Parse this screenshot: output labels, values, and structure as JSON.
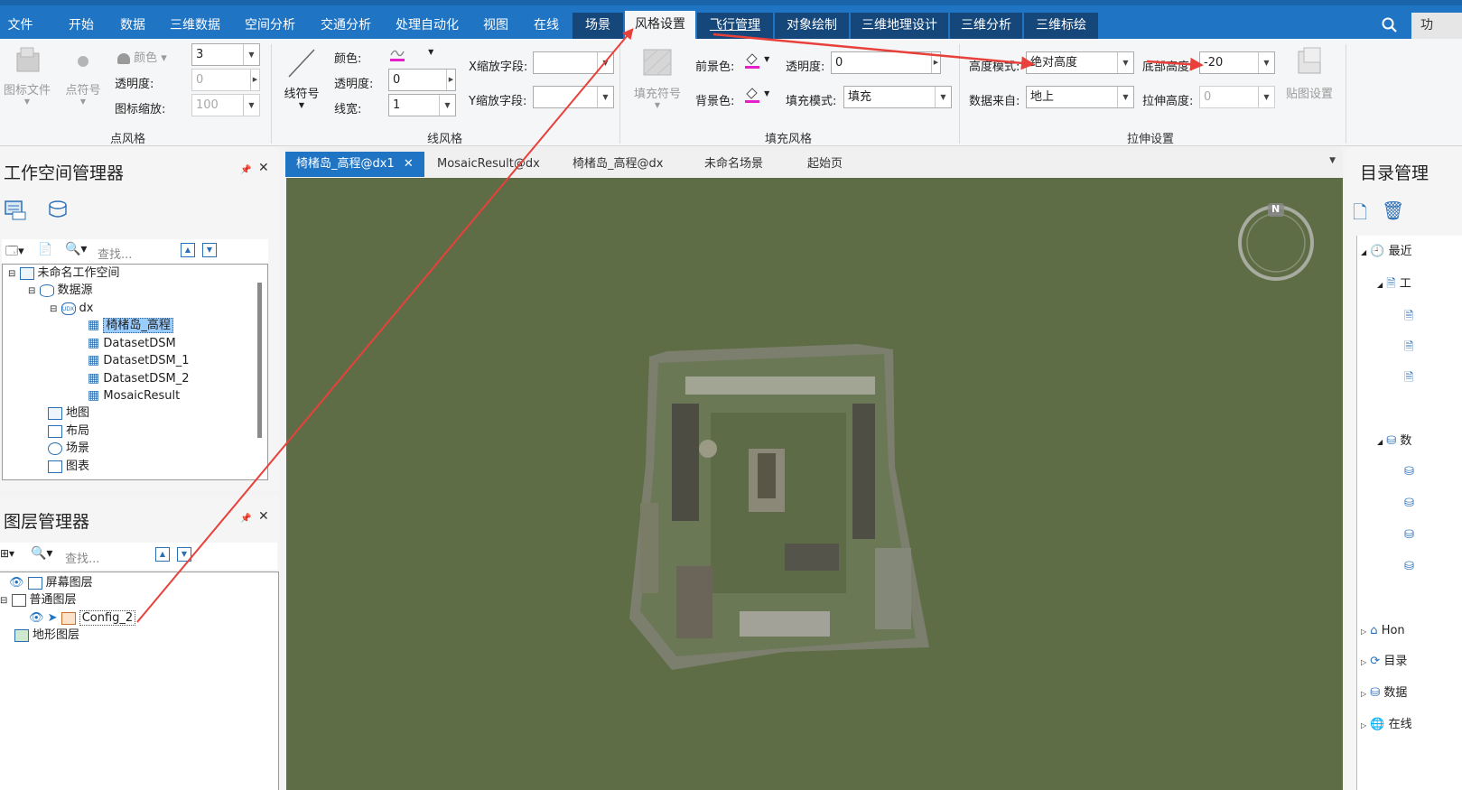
{
  "menu": {
    "items": [
      "文件",
      "开始",
      "数据",
      "三维数据",
      "空间分析",
      "交通分析",
      "处理自动化",
      "视图",
      "在线",
      "场景",
      "风格设置",
      "飞行管理",
      "对象绘制",
      "三维地理设计",
      "三维分析",
      "三维标绘"
    ],
    "search_partial": "功"
  },
  "ribbon": {
    "point_style": {
      "icon_file": "图标文件",
      "point_symbol": "点符号",
      "color": "颜色",
      "size_value": "3",
      "transparency": "透明度:",
      "transparency_value": "0",
      "icon_scale": "图标缩放:",
      "icon_scale_value": "100",
      "group": "点风格"
    },
    "line_style": {
      "line_symbol": "线符号",
      "color": "颜色:",
      "transparency": "透明度:",
      "transparency_value": "0",
      "line_width": "线宽:",
      "line_width_value": "1",
      "x_scale_field": "X缩放字段:",
      "y_scale_field": "Y缩放字段:",
      "group": "线风格"
    },
    "fill_style": {
      "fill_symbol": "填充符号",
      "foreground": "前景色:",
      "background": "背景色:",
      "transparency": "透明度:",
      "transparency_value": "0",
      "fill_mode": "填充模式:",
      "fill_mode_value": "填充",
      "group": "填充风格"
    },
    "extrude": {
      "height_mode": "高度模式:",
      "height_mode_value": "绝对高度",
      "bottom_height": "底部高度:",
      "bottom_height_value": "-20",
      "data_from": "数据来自:",
      "data_from_value": "地上",
      "extrude_height": "拉伸高度:",
      "extrude_height_value": "0",
      "texture_settings": "贴图设置",
      "group": "拉伸设置"
    }
  },
  "workspace": {
    "title": "工作空间管理器",
    "search_placeholder": "查找...",
    "tree": [
      "未命名工作空间",
      "数据源",
      "dx",
      "椅楮岛_高程",
      "DatasetDSM",
      "DatasetDSM_1",
      "DatasetDSM_2",
      "MosaicResult",
      "地图",
      "布局",
      "场景",
      "图表"
    ],
    "udx_badge": "UDX"
  },
  "layers": {
    "title": "图层管理器",
    "search_placeholder": "查找...",
    "tree": [
      "屏幕图层",
      "普通图层",
      "Config_2",
      "地形图层"
    ]
  },
  "doc_tabs": [
    "椅楮岛_高程@dx1",
    "MosaicResult@dx",
    "椅楮岛_高程@dx",
    "未命名场景",
    "起始页"
  ],
  "catalog": {
    "title": "目录管理",
    "items": [
      "最近",
      "工",
      "数",
      "Hon",
      "目录",
      "数据",
      "在线"
    ]
  },
  "compass": {
    "label": "N"
  },
  "colors": {
    "menu": "#1f74c4",
    "active_tab": "#1f74c4",
    "viewport": "#5e6d45",
    "annotation": "#e8403a",
    "highlight": "#99ccff"
  }
}
